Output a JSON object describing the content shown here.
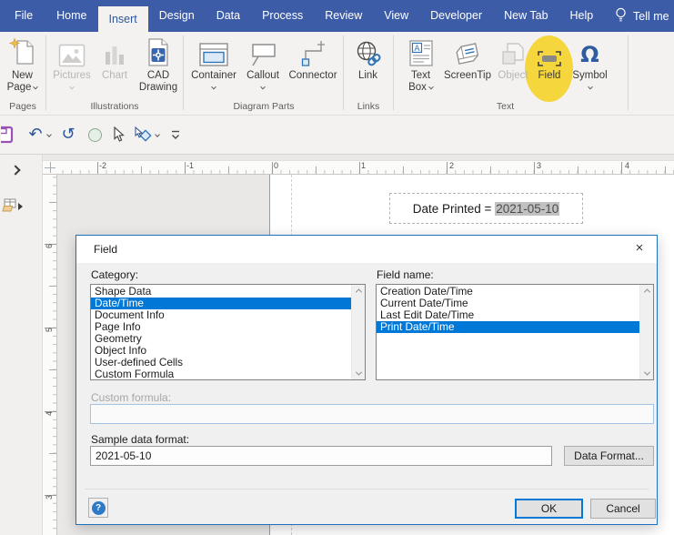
{
  "topbar": {
    "tabs": [
      "File",
      "Home",
      "Insert",
      "Design",
      "Data",
      "Process",
      "Review",
      "View",
      "Developer",
      "New Tab",
      "Help"
    ],
    "active_tab": "Insert",
    "tell_me": "Tell me"
  },
  "ribbon": {
    "groups": [
      "Pages",
      "Illustrations",
      "Diagram Parts",
      "Links",
      "Text"
    ],
    "labels": {
      "new_page1": "New",
      "new_page2": "Page",
      "pictures": "Pictures",
      "chart": "Chart",
      "cad1": "CAD",
      "cad2": "Drawing",
      "container": "Container",
      "callout": "Callout",
      "connector": "Connector",
      "link": "Link",
      "textbox1": "Text",
      "textbox2": "Box",
      "screentip": "ScreenTip",
      "object": "Object",
      "field": "Field",
      "symbol": "Symbol"
    },
    "disabled_buttons": [
      "Pictures",
      "Chart",
      "Object"
    ],
    "highlighted_button": "Field",
    "highlight_color": "#f5d63d"
  },
  "icons": {
    "undo": "↶",
    "redo": "↺",
    "omega": "Ω"
  },
  "canvas": {
    "h_ruler": [
      "-2",
      "-1",
      "0",
      "1",
      "2",
      "3",
      "4"
    ],
    "v_ruler": [
      "6",
      "5",
      "4",
      "3"
    ],
    "shape": {
      "text": "Date Printed = ",
      "field_value": "2021-05-10"
    }
  },
  "dialog": {
    "title": "Field",
    "close": "×",
    "category_label": "Category:",
    "categories": [
      "Shape Data",
      "Date/Time",
      "Document Info",
      "Page Info",
      "Geometry",
      "Object Info",
      "User-defined Cells",
      "Custom Formula"
    ],
    "selected_category": "Date/Time",
    "field_name_label": "Field name:",
    "field_names": [
      "Creation Date/Time",
      "Current Date/Time",
      "Last Edit Date/Time",
      "Print Date/Time"
    ],
    "selected_field_name": "Print Date/Time",
    "custom_formula_label": "Custom formula:",
    "custom_formula_value": "",
    "sample_label": "Sample data format:",
    "sample_value": "2021-05-10",
    "data_format_button": "Data Format...",
    "help_button": "?",
    "ok_button": "OK",
    "cancel_button": "Cancel",
    "selection_color": "#0078d7",
    "border_color": "#2071bc"
  }
}
